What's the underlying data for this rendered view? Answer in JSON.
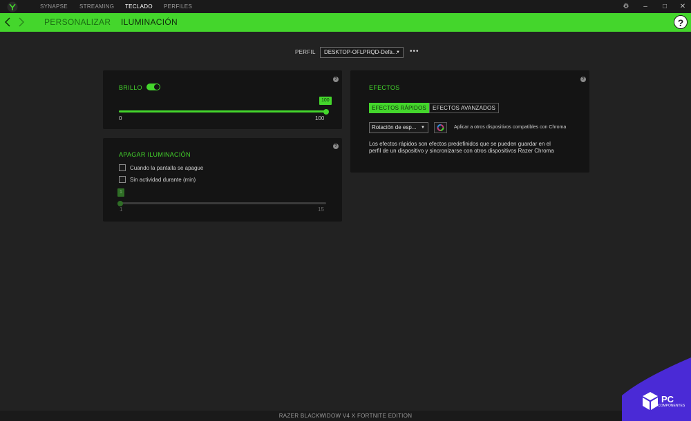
{
  "topbar": {
    "nav": [
      "SYNAPSE",
      "STREAMING",
      "TECLADO",
      "PERFILES"
    ],
    "active_index": 2,
    "controls": {
      "settings": "⚙",
      "minimize": "–",
      "maximize": "□",
      "close": "✕"
    }
  },
  "subnav": {
    "items": [
      "PERSONALIZAR",
      "ILUMINACIÓN"
    ],
    "active_index": 1,
    "help": "?"
  },
  "profile": {
    "label": "PERFIL",
    "value": "DESKTOP-OFLPRQD-Defa...",
    "more": "•••"
  },
  "brightness": {
    "title": "BRILLO",
    "enabled": true,
    "value": "100",
    "min": "0",
    "max": "100",
    "fraction": 1.0,
    "info": "?"
  },
  "lighting_off": {
    "title": "APAGAR ILUMINACIÓN",
    "info": "?",
    "options": [
      "Cuando la pantalla se apague",
      "Sin actividad durante (min)"
    ],
    "slider_value": "1",
    "min": "1",
    "max": "15",
    "fraction": 0.0
  },
  "effects": {
    "title": "EFECTOS",
    "info": "?",
    "tabs": [
      "EFECTOS RÁPIDOS",
      "EFECTOS AVANZADOS"
    ],
    "active_tab": 0,
    "selected_effect": "Rotación de esp...",
    "apply_text": "Aplicar a otros dispositivos compatibles con Chroma",
    "description": "Los efectos rápidos son efectos predefinidos que se pueden guardar en el perfil de un dispositivo y sincronizarse con otros dispositivos Razer Chroma"
  },
  "footer": {
    "device": "RAZER BLACKWIDOW V4 X FORTNITE EDITION"
  },
  "watermark": {
    "brand": "PC",
    "sub": "COMPONENTES"
  },
  "colors": {
    "accent": "#44d62c",
    "background": "#222222",
    "panel": "#141414",
    "watermark": "#4a2ad6"
  }
}
